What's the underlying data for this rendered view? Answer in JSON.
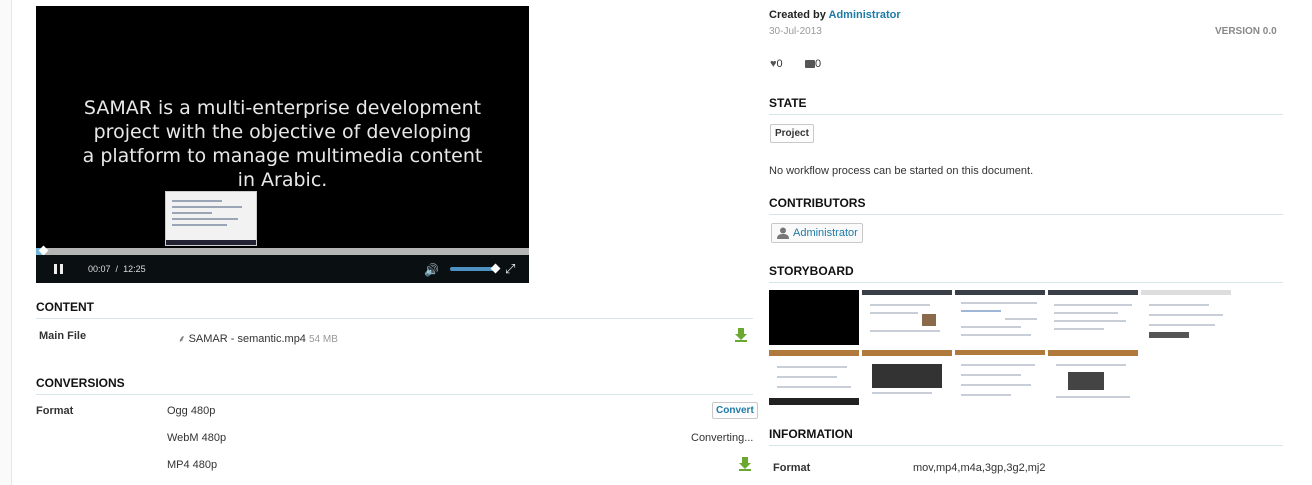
{
  "video": {
    "overlay_text_lines": [
      "SAMAR is a multi-enterprise development",
      "project with the objective of developing",
      "a platform to manage multimedia content",
      "in Arabic."
    ],
    "current_time": "00:07",
    "separator": "/",
    "duration": "12:25",
    "progress_fraction": 0.01,
    "volume_fraction": 1.0
  },
  "content": {
    "title": "CONTENT",
    "main_file_label": "Main File",
    "file_name": "SAMAR - semantic.mp4",
    "file_size": "54 MB"
  },
  "conversions": {
    "title": "CONVERSIONS",
    "format_label": "Format",
    "rows": [
      {
        "name": "Ogg 480p",
        "action": "Convert"
      },
      {
        "name": "WebM 480p",
        "status": "Converting..."
      },
      {
        "name": "MP4 480p",
        "action": "download"
      }
    ]
  },
  "meta": {
    "created_by_label": "Created by",
    "author": "Administrator",
    "date": "30-Jul-2013",
    "version": "VERSION 0.0",
    "likes": "0",
    "comments": "0"
  },
  "state": {
    "title": "STATE",
    "badge": "Project",
    "message": "No workflow process can be started on this document."
  },
  "contributors": {
    "title": "CONTRIBUTORS",
    "items": [
      "Administrator"
    ]
  },
  "storyboard": {
    "title": "STORYBOARD",
    "frame_count": 9
  },
  "information": {
    "title": "INFORMATION",
    "format_label": "Format",
    "format_value": "mov,mp4,m4a,3gp,3g2,mj2"
  },
  "colors": {
    "link": "#1e7aa6",
    "section_rule": "#d6e6e8",
    "download_green": "#6aa832"
  }
}
